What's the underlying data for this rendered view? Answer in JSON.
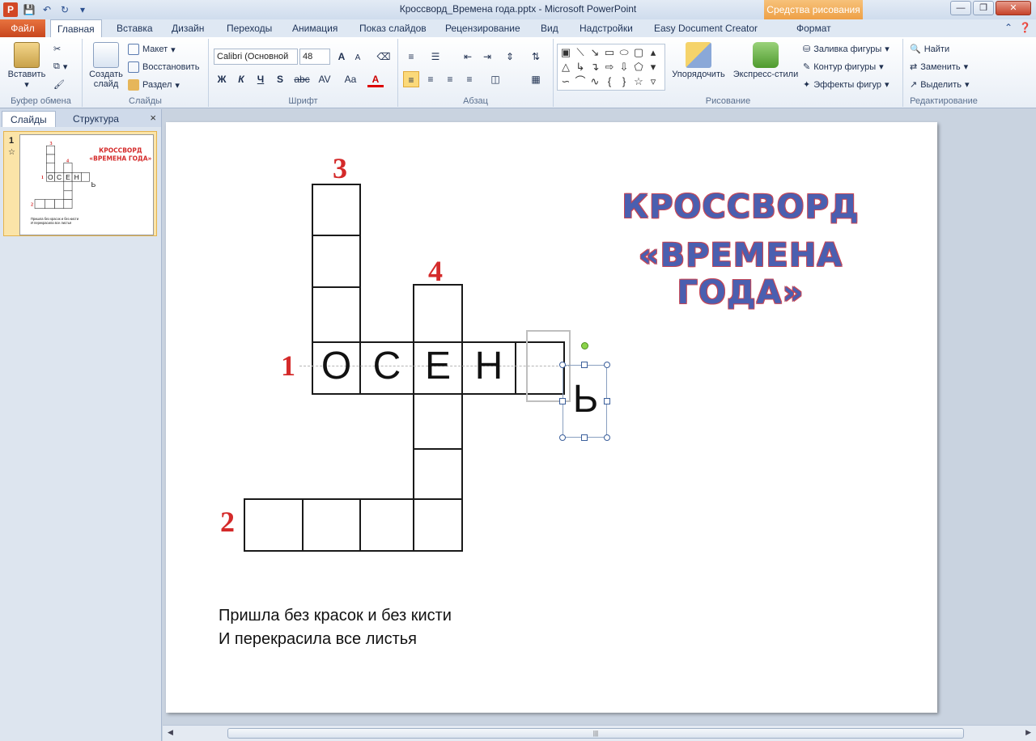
{
  "window": {
    "title": "Кроссворд_Времена года.pptx - Microsoft PowerPoint",
    "context_tab_header": "Средства рисования",
    "app_logo": "P",
    "controls": [
      "—",
      "❐",
      "✕"
    ]
  },
  "tabs": [
    "Файл",
    "Главная",
    "Вставка",
    "Дизайн",
    "Переходы",
    "Анимация",
    "Показ слайдов",
    "Рецензирование",
    "Вид",
    "Надстройки",
    "Easy Document Creator",
    "Формат"
  ],
  "ribbon": {
    "clipboard": {
      "paste": "Вставить",
      "label": "Буфер обмена"
    },
    "slides": {
      "new_slide": "Создать слайд",
      "layout": "Макет",
      "reset": "Восстановить",
      "section": "Раздел",
      "label": "Слайды"
    },
    "font": {
      "name": "Calibri (Основной",
      "size": "48",
      "bold": "Ж",
      "italic": "К",
      "underline": "Ч",
      "shadow": "S",
      "strike": "abc",
      "spacing": "AV",
      "case": "Aa",
      "color_letter": "A",
      "grow": "A",
      "shrink": "A",
      "label": "Шрифт"
    },
    "paragraph": {
      "label": "Абзац"
    },
    "drawing": {
      "arrange": "Упорядочить",
      "quick_styles": "Экспресс-стили",
      "fill": "Заливка фигуры",
      "outline": "Контур фигуры",
      "effects": "Эффекты фигур",
      "label": "Рисование"
    },
    "editing": {
      "find": "Найти",
      "replace": "Заменить",
      "select": "Выделить",
      "label": "Редактирование"
    }
  },
  "panel": {
    "tab_slides": "Слайды",
    "tab_outline": "Структура",
    "close": "×",
    "slide_number": "1"
  },
  "slide": {
    "title_line1": "КРОССВОРД",
    "title_line2": "«ВРЕМЕНА ГОДА»",
    "numbers": {
      "n1": "1",
      "n2": "2",
      "n3": "3",
      "n4": "4"
    },
    "letters": [
      "О",
      "С",
      "Е",
      "Н"
    ],
    "selected_letter": "Ь",
    "riddle_line1": "Пришла без красок и без кисти",
    "riddle_line2": "И перекрасила все листья"
  },
  "thumb": {
    "title_line1": "КРОССВОРД",
    "title_line2": "«ВРЕМЕНА ГОДА»",
    "letters": [
      "О",
      "С",
      "Е",
      "Н"
    ],
    "selected_letter": "Ь",
    "n1": "1",
    "n2": "2",
    "n3": "3",
    "n4": "4",
    "riddle_line1": "Пришла без красок и без кисти",
    "riddle_line2": "И перекрасила все листья"
  },
  "colors": {
    "accent_file": "#d24726",
    "number_red": "#d42a2a",
    "title_blue": "#4a5fb0",
    "context_orange": "#eea046"
  },
  "icons": [
    "save-icon",
    "undo-icon",
    "redo-icon",
    "paste-icon",
    "scissors-icon",
    "copy-icon",
    "format-painter-icon",
    "new-slide-icon",
    "find-icon",
    "replace-icon",
    "select-icon",
    "help-icon"
  ]
}
